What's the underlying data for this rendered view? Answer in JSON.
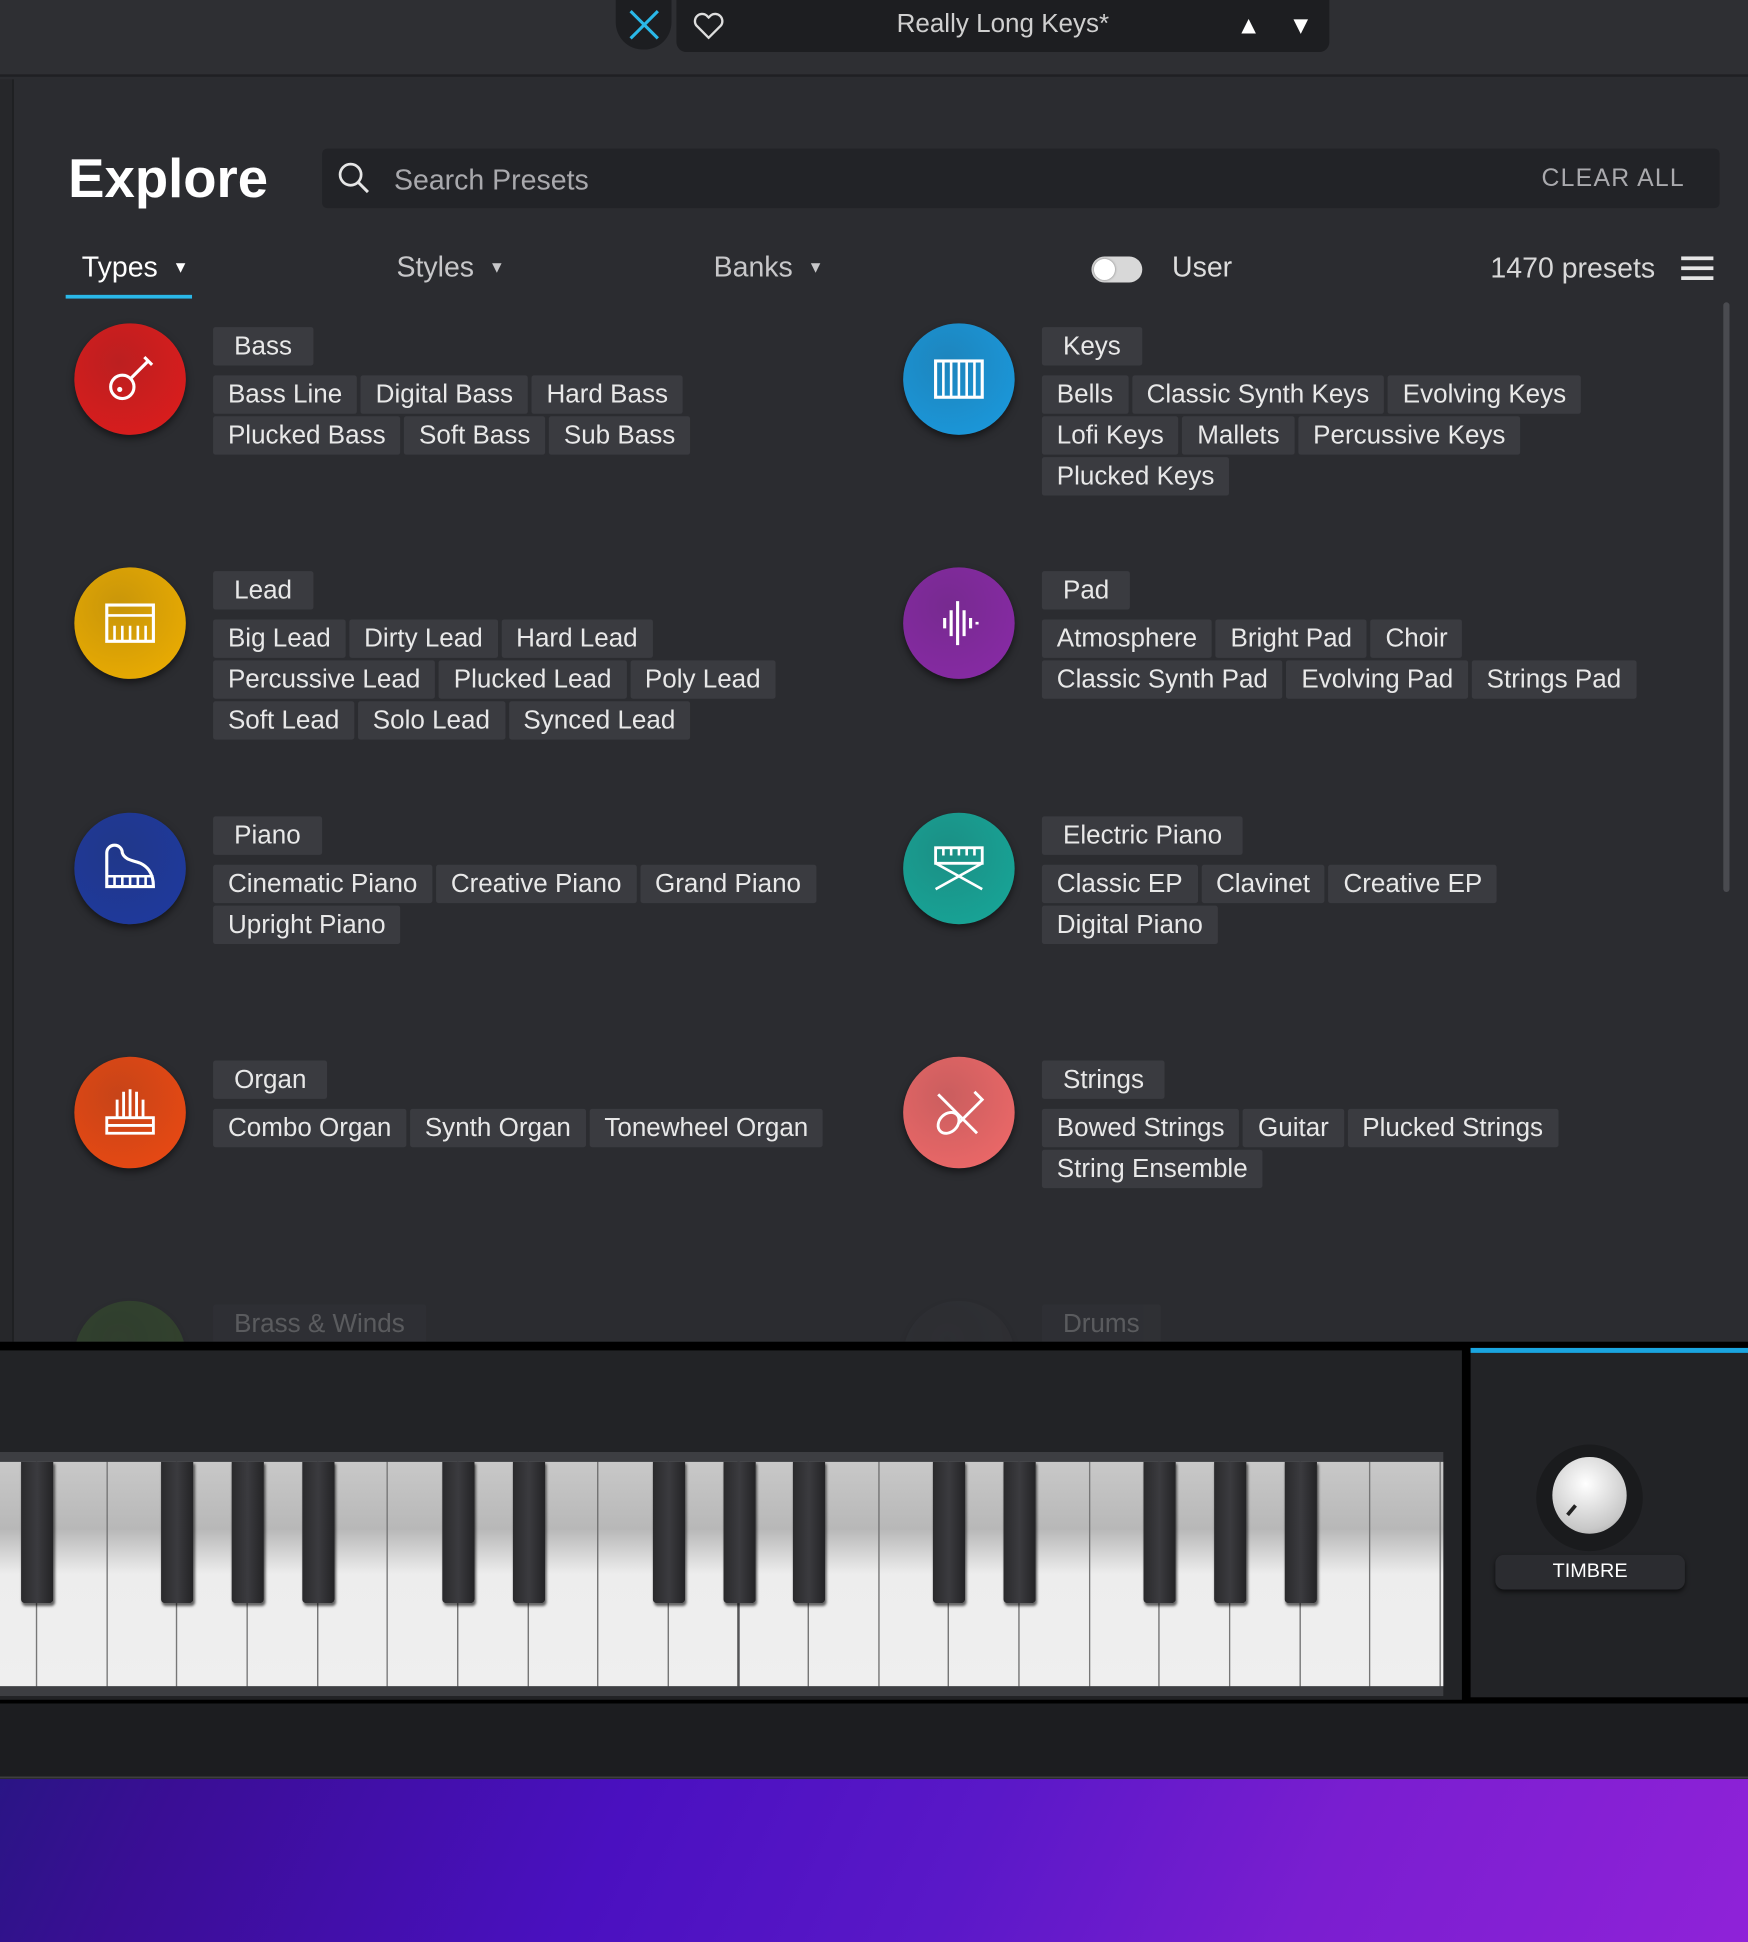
{
  "header": {
    "preset_name": "Really Long Keys*",
    "prev_label": "▲",
    "next_label": "▼"
  },
  "explore": {
    "title": "Explore",
    "search": {
      "placeholder": "Search Presets",
      "clear_label": "CLEAR ALL"
    },
    "tabs": [
      {
        "label": "Types",
        "active": true
      },
      {
        "label": "Styles"
      },
      {
        "label": "Banks"
      }
    ],
    "user_toggle": {
      "label": "User",
      "on": false
    },
    "preset_count": "1470 presets",
    "accent": "#2ab8e8"
  },
  "categories": [
    {
      "name": "Bass",
      "icon": "guitar-icon",
      "color": "#e01c1c",
      "rows": [
        [
          "Bass Line",
          "Digital Bass",
          "Hard Bass"
        ],
        [
          "Plucked Bass",
          "Soft Bass",
          "Sub Bass"
        ]
      ]
    },
    {
      "name": "Keys",
      "icon": "keyboard-icon",
      "color": "#1a9be0",
      "rows": [
        [
          "Bells",
          "Classic Synth Keys",
          "Evolving Keys"
        ],
        [
          "Lofi Keys",
          "Mallets",
          "Percussive Keys"
        ],
        [
          "Plucked Keys"
        ]
      ]
    },
    {
      "name": "Lead",
      "icon": "synth-icon",
      "color": "#f0b000",
      "rows": [
        [
          "Big Lead",
          "Dirty Lead",
          "Hard Lead"
        ],
        [
          "Percussive Lead",
          "Plucked Lead",
          "Poly Lead"
        ],
        [
          "Soft Lead",
          "Solo Lead",
          "Synced Lead"
        ]
      ]
    },
    {
      "name": "Pad",
      "icon": "waveform-icon",
      "color": "#8a2aa8",
      "rows": [
        [
          "Atmosphere",
          "Bright Pad",
          "Choir"
        ],
        [
          "Classic Synth Pad",
          "Evolving Pad",
          "Strings Pad"
        ]
      ]
    },
    {
      "name": "Piano",
      "icon": "grand-piano-icon",
      "color": "#1e3aa0",
      "rows": [
        [
          "Cinematic Piano",
          "Creative Piano",
          "Grand Piano"
        ],
        [
          "Upright Piano"
        ]
      ]
    },
    {
      "name": "Electric Piano",
      "icon": "electric-piano-icon",
      "color": "#17a89a",
      "rows": [
        [
          "Classic EP",
          "Clavinet",
          "Creative EP"
        ],
        [
          "Digital Piano"
        ]
      ]
    },
    {
      "name": "Organ",
      "icon": "organ-icon",
      "color": "#ee4a12",
      "rows": [
        [
          "Combo Organ",
          "Synth Organ",
          "Tonewheel Organ"
        ]
      ]
    },
    {
      "name": "Strings",
      "icon": "violin-icon",
      "color": "#f26a6a",
      "rows": [
        [
          "Bowed Strings",
          "Guitar",
          "Plucked Strings"
        ],
        [
          "String Ensemble"
        ]
      ]
    },
    {
      "name": "Brass & Winds",
      "icon": "brass-icon",
      "color": "#4a8a2a",
      "rows": []
    },
    {
      "name": "Drums",
      "icon": "drum-icon",
      "color": "#3a3b40",
      "rows": []
    }
  ],
  "controls": {
    "knob_label": "TIMBRE"
  }
}
